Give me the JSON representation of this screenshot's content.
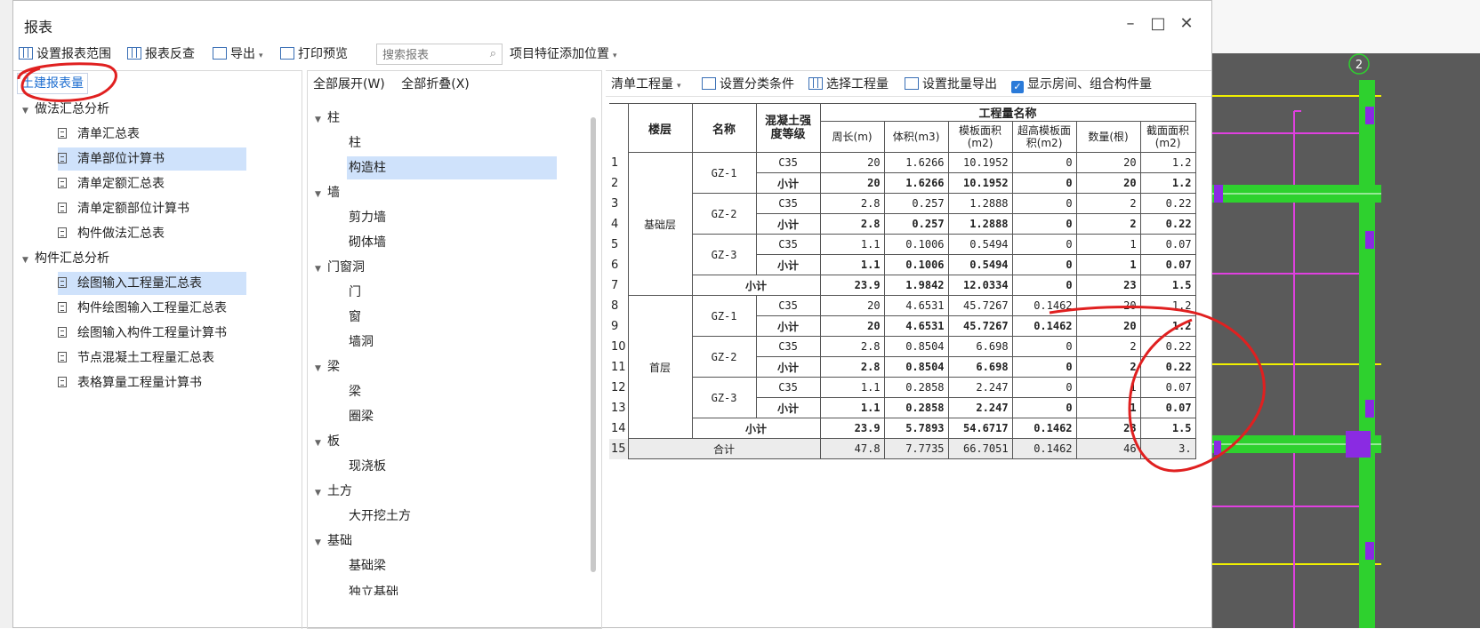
{
  "window": {
    "title": "报表"
  },
  "toolbar": {
    "set_range": "设置报表范围",
    "reverse_check": "报表反查",
    "export": "导出",
    "print_preview": "打印预览",
    "search_placeholder": "搜索报表",
    "add_feature": "项目特征添加位置"
  },
  "left_tab": "土建报表量",
  "left_tree": {
    "group1": "做法汇总分析",
    "group1_items": [
      "清单汇总表",
      "清单部位计算书",
      "清单定额汇总表",
      "清单定额部位计算书",
      "构件做法汇总表"
    ],
    "group2": "构件汇总分析",
    "group2_items": [
      "绘图输入工程量汇总表",
      "构件绘图输入工程量汇总表",
      "绘图输入构件工程量计算书",
      "节点混凝土工程量汇总表",
      "表格算量工程量计算书"
    ]
  },
  "mid": {
    "expand_all": "全部展开(W)",
    "collapse_all": "全部折叠(X)",
    "tree": [
      {
        "label": "柱",
        "children": [
          "柱",
          "构造柱"
        ]
      },
      {
        "label": "墙",
        "children": [
          "剪力墙",
          "砌体墙"
        ]
      },
      {
        "label": "门窗洞",
        "children": [
          "门",
          "窗",
          "墙洞"
        ]
      },
      {
        "label": "梁",
        "children": [
          "梁",
          "圈梁"
        ]
      },
      {
        "label": "板",
        "children": [
          "现浇板"
        ]
      },
      {
        "label": "土方",
        "children": [
          "大开挖土方"
        ]
      },
      {
        "label": "基础",
        "children": [
          "基础梁",
          "独立基础"
        ]
      }
    ]
  },
  "right_toolbar": {
    "qty_type": "清单工程量",
    "set_cond": "设置分类条件",
    "select_qty": "选择工程量",
    "batch_export": "设置批量导出",
    "show_room": "显示房间、组合构件量"
  },
  "table": {
    "headers": {
      "floor": "楼层",
      "name": "名称",
      "grade": "混凝土强度等级",
      "qty_name": "工程量名称",
      "perimeter": "周长(m)",
      "volume": "体积(m3)",
      "formwork": "模板面积(m2)",
      "high_formwork": "超高模板面积(m2)",
      "count": "数量(根)",
      "section": "截面面积(m2)"
    },
    "floors": [
      {
        "floor": "基础层",
        "groups": [
          {
            "name": "GZ-1",
            "detail": [
              "C35",
              "20",
              "1.6266",
              "10.1952",
              "0",
              "20",
              "1.2"
            ],
            "subtotal": [
              "小计",
              "20",
              "1.6266",
              "10.1952",
              "0",
              "20",
              "1.2"
            ]
          },
          {
            "name": "GZ-2",
            "detail": [
              "C35",
              "2.8",
              "0.257",
              "1.2888",
              "0",
              "2",
              "0.22"
            ],
            "subtotal": [
              "小计",
              "2.8",
              "0.257",
              "1.2888",
              "0",
              "2",
              "0.22"
            ]
          },
          {
            "name": "GZ-3",
            "detail": [
              "C35",
              "1.1",
              "0.1006",
              "0.5494",
              "0",
              "1",
              "0.07"
            ],
            "subtotal": [
              "小计",
              "1.1",
              "0.1006",
              "0.5494",
              "0",
              "1",
              "0.07"
            ]
          }
        ],
        "floor_total": [
          "小计",
          "23.9",
          "1.9842",
          "12.0334",
          "0",
          "23",
          "1.5"
        ]
      },
      {
        "floor": "首层",
        "groups": [
          {
            "name": "GZ-1",
            "detail": [
              "C35",
              "20",
              "4.6531",
              "45.7267",
              "0.1462",
              "20",
              "1.2"
            ],
            "subtotal": [
              "小计",
              "20",
              "4.6531",
              "45.7267",
              "0.1462",
              "20",
              "1.2"
            ]
          },
          {
            "name": "GZ-2",
            "detail": [
              "C35",
              "2.8",
              "0.8504",
              "6.698",
              "0",
              "2",
              "0.22"
            ],
            "subtotal": [
              "小计",
              "2.8",
              "0.8504",
              "6.698",
              "0",
              "2",
              "0.22"
            ]
          },
          {
            "name": "GZ-3",
            "detail": [
              "C35",
              "1.1",
              "0.2858",
              "2.247",
              "0",
              "1",
              "0.07"
            ],
            "subtotal": [
              "小计",
              "1.1",
              "0.2858",
              "2.247",
              "0",
              "1",
              "0.07"
            ]
          }
        ],
        "floor_total": [
          "小计",
          "23.9",
          "5.7893",
          "54.6717",
          "0.1462",
          "23",
          "1.5"
        ]
      }
    ],
    "grand_total": [
      "合计",
      "47.8",
      "7.7735",
      "66.7051",
      "0.1462",
      "46",
      "3."
    ]
  },
  "canvas": {
    "axis_label": "2"
  },
  "colors": {
    "accent": "#1f6fd1",
    "annotation": "#e02020",
    "canvas_bg": "#5a5a5a",
    "member_green": "#2ed12e",
    "axis_pink": "#e040e0",
    "axis_yellow": "#f0f000",
    "node_purple": "#8a2be2"
  }
}
